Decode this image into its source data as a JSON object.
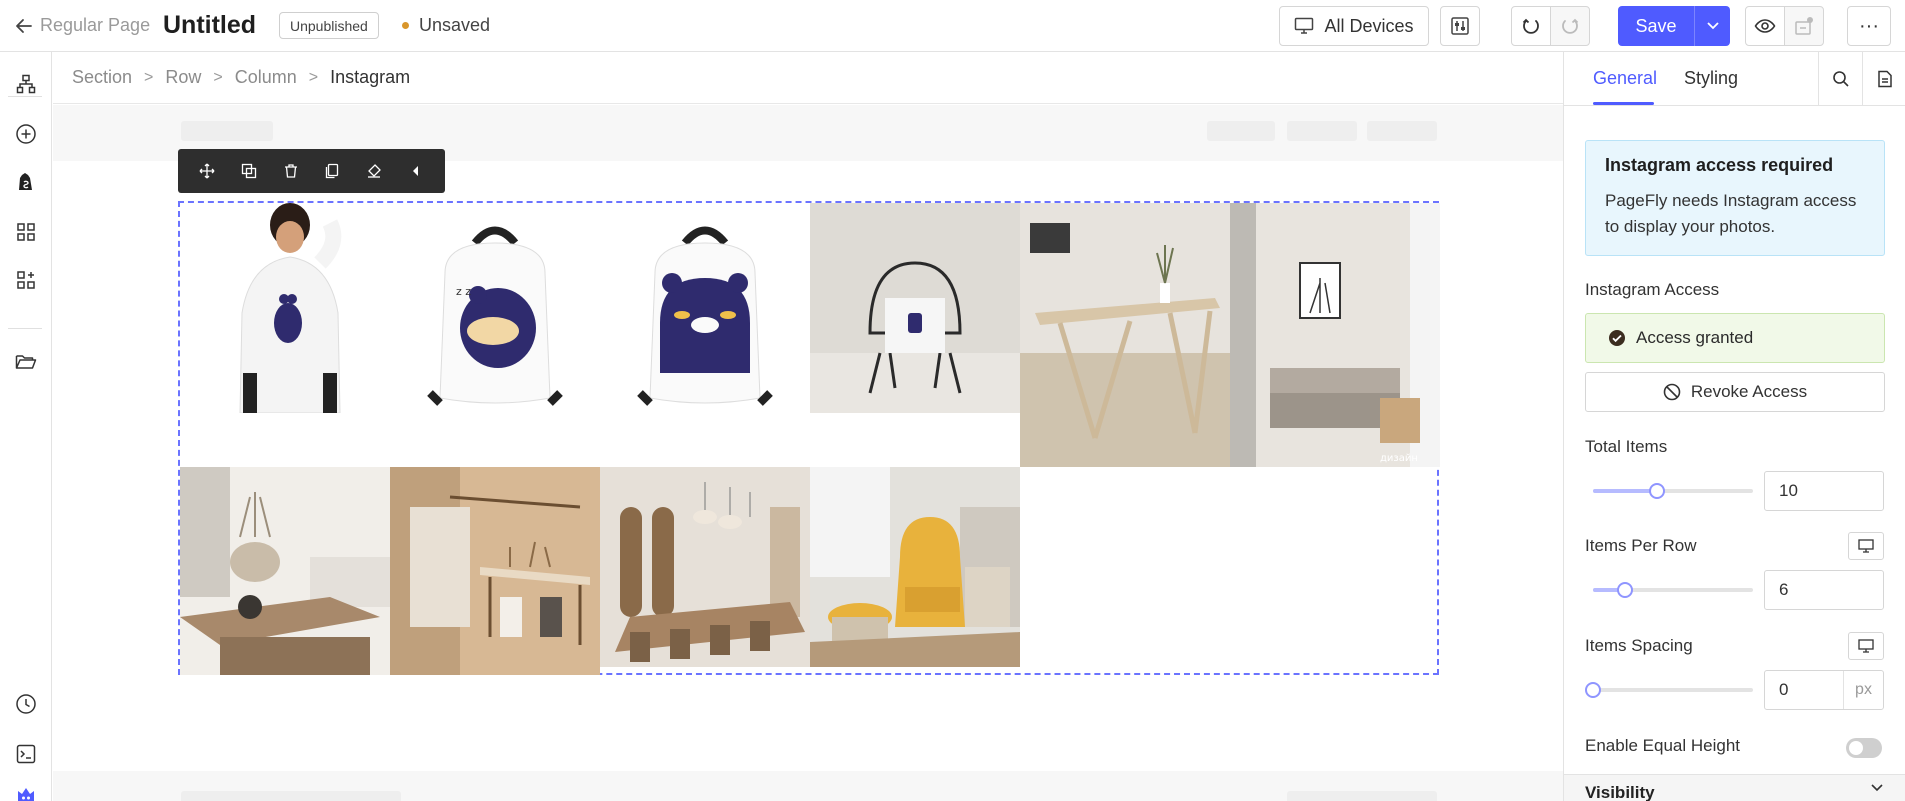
{
  "header": {
    "page_type": "Regular Page",
    "page_title": "Untitled",
    "status_badge": "Unpublished",
    "save_state": "Unsaved",
    "devices_label": "All Devices",
    "save_label": "Save",
    "more_label": "···"
  },
  "breadcrumb": {
    "items": [
      "Section",
      "Row",
      "Column",
      "Instagram"
    ],
    "separator": ">"
  },
  "panel": {
    "tabs": [
      {
        "label": "General",
        "active": true
      },
      {
        "label": "Styling",
        "active": false
      }
    ],
    "info_title": "Instagram access required",
    "info_text": "PageFly needs Instagram access to display your photos.",
    "access_label": "Instagram Access",
    "access_status": "Access granted",
    "revoke_label": "Revoke Access",
    "total_items": {
      "label": "Total Items",
      "value": "10",
      "fraction": 0.4
    },
    "items_per_row": {
      "label": "Items Per Row",
      "value": "6",
      "fraction": 0.2
    },
    "items_spacing": {
      "label": "Items Spacing",
      "value": "0",
      "unit": "px",
      "fraction": 0
    },
    "equal_height": {
      "label": "Enable Equal Height",
      "enabled": false
    },
    "visibility_label": "Visibility"
  },
  "instagram": {
    "watermark": "дизайн"
  },
  "colors": {
    "accent": "#4f5bff",
    "info_bg": "#e8f6fd",
    "success_bg": "#f1f9e8",
    "unsaved_dot": "#d9962b"
  }
}
